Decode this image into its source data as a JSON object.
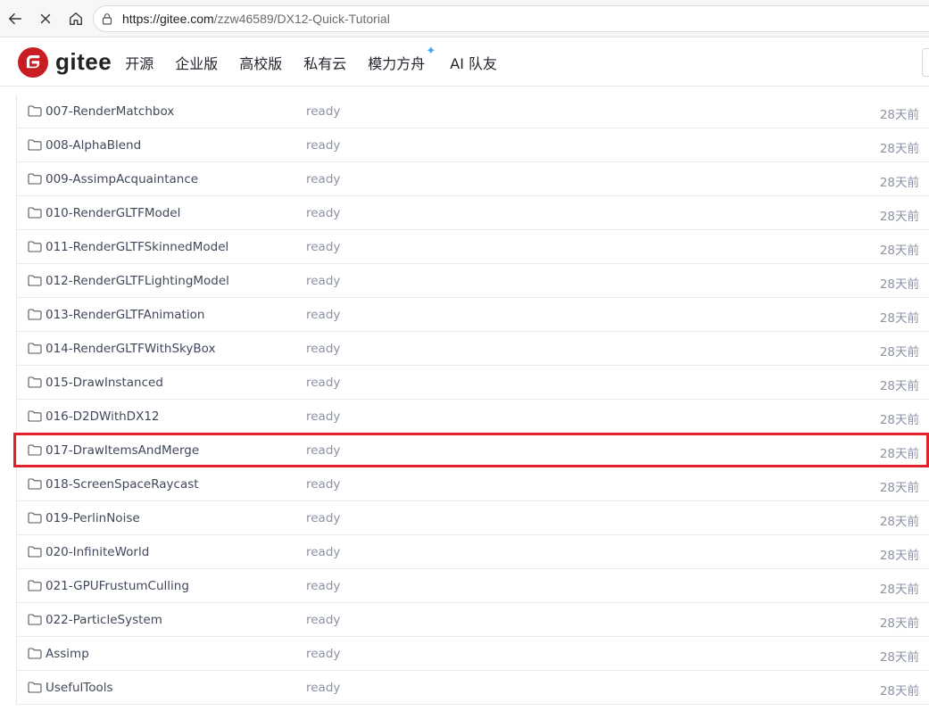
{
  "browser": {
    "url_host": "https://gitee.com",
    "url_path": "/zzw46589/DX12-Quick-Tutorial"
  },
  "header": {
    "logo_text": "gitee",
    "nav": [
      {
        "label": "开源"
      },
      {
        "label": "企业版"
      },
      {
        "label": "高校版"
      },
      {
        "label": "私有云"
      },
      {
        "label": "模力方舟"
      },
      {
        "label": "AI 队友"
      }
    ]
  },
  "files": [
    {
      "name": "007-RenderMatchbox",
      "message": "ready",
      "time": "28天前"
    },
    {
      "name": "008-AlphaBlend",
      "message": "ready",
      "time": "28天前"
    },
    {
      "name": "009-AssimpAcquaintance",
      "message": "ready",
      "time": "28天前"
    },
    {
      "name": "010-RenderGLTFModel",
      "message": "ready",
      "time": "28天前"
    },
    {
      "name": "011-RenderGLTFSkinnedModel",
      "message": "ready",
      "time": "28天前"
    },
    {
      "name": "012-RenderGLTFLightingModel",
      "message": "ready",
      "time": "28天前"
    },
    {
      "name": "013-RenderGLTFAnimation",
      "message": "ready",
      "time": "28天前"
    },
    {
      "name": "014-RenderGLTFWithSkyBox",
      "message": "ready",
      "time": "28天前"
    },
    {
      "name": "015-DrawInstanced",
      "message": "ready",
      "time": "28天前"
    },
    {
      "name": "016-D2DWithDX12",
      "message": "ready",
      "time": "28天前"
    },
    {
      "name": "017-DrawItemsAndMerge",
      "message": "ready",
      "time": "28天前"
    },
    {
      "name": "018-ScreenSpaceRaycast",
      "message": "ready",
      "time": "28天前"
    },
    {
      "name": "019-PerlinNoise",
      "message": "ready",
      "time": "28天前"
    },
    {
      "name": "020-InfiniteWorld",
      "message": "ready",
      "time": "28天前"
    },
    {
      "name": "021-GPUFrustumCulling",
      "message": "ready",
      "time": "28天前"
    },
    {
      "name": "022-ParticleSystem",
      "message": "ready",
      "time": "28天前"
    },
    {
      "name": "Assimp",
      "message": "ready",
      "time": "28天前"
    },
    {
      "name": "UsefulTools",
      "message": "ready",
      "time": "28天前"
    }
  ],
  "colors": {
    "brand": "#c71d23",
    "highlight": "#e0232b",
    "sparkle": "#39a3f4"
  }
}
